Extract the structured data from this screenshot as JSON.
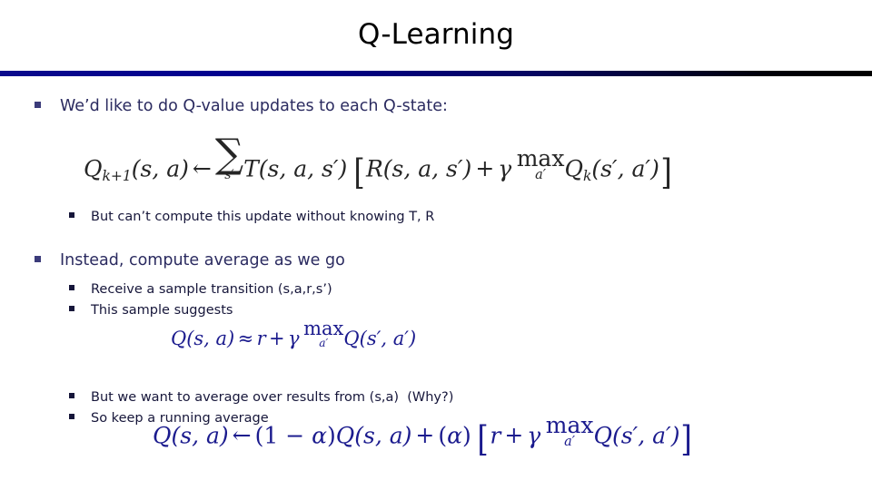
{
  "slide": {
    "title": "Q-Learning",
    "divider_color_left": "#00008f",
    "divider_color_right": "#000000",
    "background": "#ffffff"
  },
  "colors": {
    "level1_text": "#2b2b60",
    "level1_bullet": "#3b3b7a",
    "level2_text": "#16163a",
    "level2_bullet": "#16163a",
    "equation_black": "#252525",
    "equation_blue": "#1b1b8e"
  },
  "content": {
    "bullets": [
      {
        "level": 1,
        "text": "We’d like to do Q-value updates to each Q-state:"
      },
      {
        "level": 2,
        "text": "But can’t compute this update without knowing T, R"
      },
      {
        "level": 1,
        "text": "Instead, compute average as we go"
      },
      {
        "level": 2,
        "text": "Receive a sample transition (s,a,r,s’)"
      },
      {
        "level": 2,
        "text": "This sample suggests"
      },
      {
        "level": 2,
        "text": "But we want to average over results from (s,a)  (Why?)"
      },
      {
        "level": 2,
        "text": "So keep a running average"
      }
    ]
  },
  "equations": {
    "eq1": {
      "latex": "Q_{k+1}(s,a) \\leftarrow \\sum_{s'} T(s,a,s') \\left[ R(s,a,s') + \\gamma \\max_{a'} Q_k(s',a') \\right]",
      "plain": "Q_{k+1}(s,a) <- sum_{s'} T(s,a,s') [ R(s,a,s') + gamma max_{a'} Q_k(s',a') ]",
      "parts": {
        "lhs_symbol": "Q",
        "lhs_subscript": "k+1",
        "lhs_args": "(s, a)",
        "arrow": "←",
        "sum_symbol": "∑",
        "sum_index": "s′",
        "transition": "T",
        "transition_args": "(s, a, s′)",
        "bracket_open": "[",
        "reward": "R",
        "reward_args": "(s, a, s′)",
        "plus": "+",
        "gamma": "γ",
        "max": "max",
        "max_index": "a′",
        "q_symbol": "Q",
        "q_subscript": "k",
        "q_args": "(s′, a′)",
        "bracket_close": "]"
      }
    },
    "eq2": {
      "latex": "Q(s,a) \\approx r + \\gamma \\max_{a'} Q(s',a')",
      "plain": "Q(s,a) ~= r + gamma max_{a'} Q(s',a')",
      "parts": {
        "lhs_symbol": "Q",
        "lhs_args": "(s, a)",
        "approx": "≈",
        "reward": "r",
        "plus": "+",
        "gamma": "γ",
        "max": "max",
        "max_index": "a′",
        "q_symbol": "Q",
        "q_args": "(s′, a′)"
      }
    },
    "eq3": {
      "latex": "Q(s,a) \\leftarrow (1-\\alpha)Q(s,a) + (\\alpha)\\left[ r + \\gamma \\max_{a'} Q(s',a') \\right]",
      "plain": "Q(s,a) <- (1-alpha)Q(s,a) + (alpha)[ r + gamma max_{a'} Q(s',a') ]",
      "parts": {
        "lhs_symbol": "Q",
        "lhs_args": "(s, a)",
        "arrow": "←",
        "one_minus_alpha": "(1 − α)",
        "q_symbol": "Q",
        "q_args": "(s, a)",
        "plus": "+",
        "alpha_group": "(α)",
        "bracket_open": "[",
        "reward": "r",
        "inner_plus": "+",
        "gamma": "γ",
        "max": "max",
        "max_index": "a′",
        "q2_symbol": "Q",
        "q2_args": "(s′, a′)",
        "bracket_close": "]"
      }
    }
  }
}
